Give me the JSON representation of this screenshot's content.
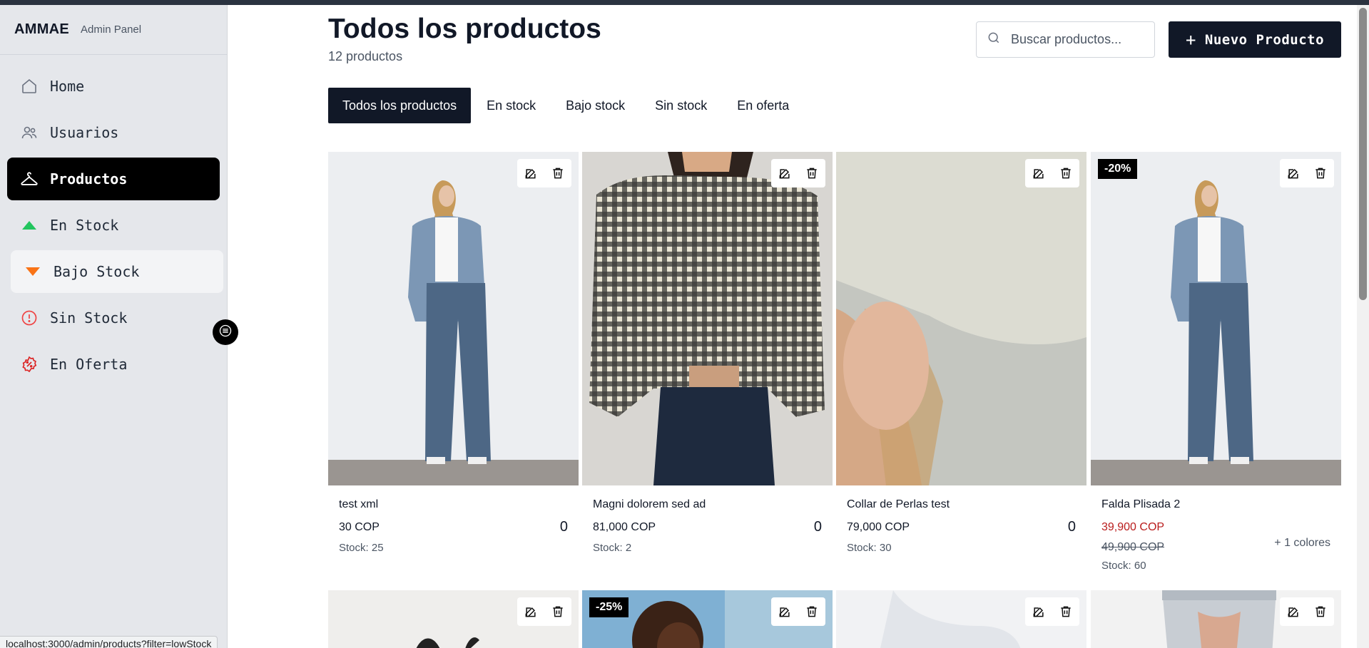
{
  "sidebar": {
    "brand": "AMMAE",
    "subtitle": "Admin Panel",
    "items": [
      {
        "label": "Home"
      },
      {
        "label": "Usuarios"
      },
      {
        "label": "Productos"
      },
      {
        "label": "En Stock"
      },
      {
        "label": "Bajo Stock"
      },
      {
        "label": "Sin Stock"
      },
      {
        "label": "En Oferta"
      }
    ]
  },
  "header": {
    "title": "Todos los productos",
    "count": "12 productos"
  },
  "search": {
    "placeholder": "Buscar productos..."
  },
  "toolbar": {
    "new_label": "Nuevo Producto"
  },
  "tabs": [
    {
      "label": "Todos los productos"
    },
    {
      "label": "En stock"
    },
    {
      "label": "Bajo stock"
    },
    {
      "label": "Sin stock"
    },
    {
      "label": "En oferta"
    }
  ],
  "products": [
    {
      "name": "test xml",
      "price": "30 COP",
      "qty": "0",
      "stock": "Stock: 25"
    },
    {
      "name": "Magni dolorem sed ad",
      "price": "81,000 COP",
      "qty": "0",
      "stock": "Stock: 2"
    },
    {
      "name": "Collar de Perlas test",
      "price": "79,000 COP",
      "qty": "0",
      "stock": "Stock: 30"
    },
    {
      "name": "Falda Plisada 2",
      "badge": "-20%",
      "price": "39,900 COP",
      "old_price": "49,900 COP",
      "colors": "+ 1 colores",
      "stock": "Stock: 60"
    },
    {},
    {
      "badge": "-25%"
    },
    {},
    {}
  ],
  "status_url": "localhost:3000/admin/products?filter=lowStock",
  "colors": {
    "accent": "#111827",
    "active_nav": "#000000",
    "in_stock": "#22c55e",
    "low_stock": "#f97316",
    "no_stock": "#ef4444",
    "offer": "#dc2626",
    "sale_price": "#b91c1c"
  },
  "icons": {
    "nav": [
      "home-icon",
      "users-icon",
      "hanger-icon",
      "triangle-up-icon",
      "triangle-down-icon",
      "alert-circle-icon",
      "discount-badge-icon"
    ],
    "search": "search-icon",
    "edit": "edit-icon",
    "delete": "trash-icon"
  }
}
